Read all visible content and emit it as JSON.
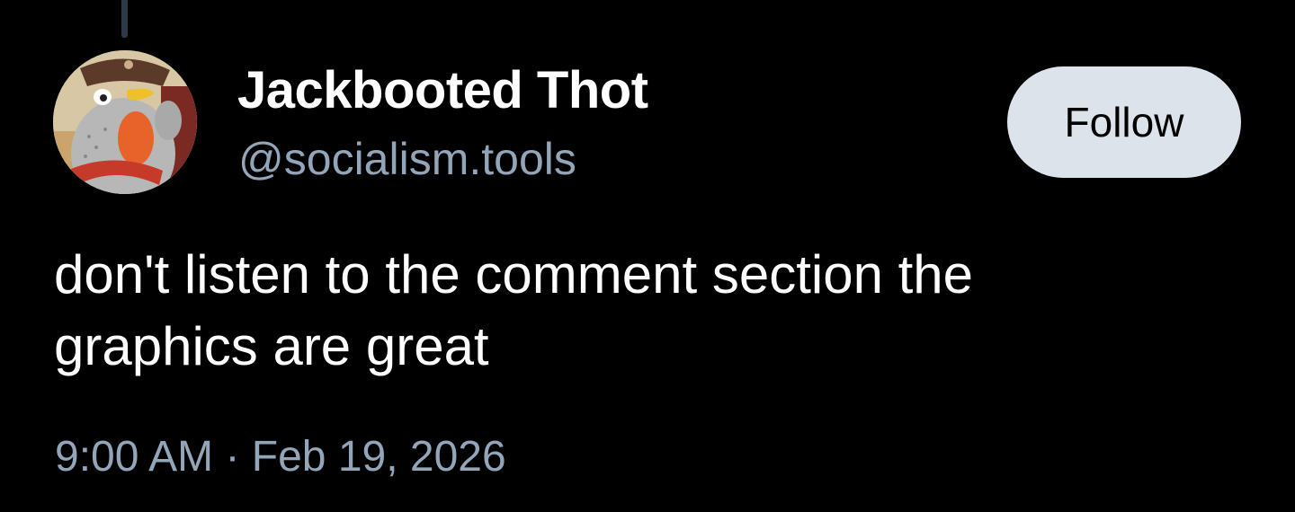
{
  "post": {
    "author": {
      "display_name": "Jackbooted Thot",
      "handle": "@socialism.tools",
      "avatar_icon": "penguin-cowboy-avatar"
    },
    "follow_label": "Follow",
    "text_lines": [
      "don't listen to the comment section the",
      "graphics are great"
    ],
    "time": "9:00 AM",
    "separator": "·",
    "date": "Feb 19, 2026"
  },
  "colors": {
    "background": "#000000",
    "primary_text": "#ffffff",
    "secondary_text": "#93a5b8",
    "follow_button_bg": "#dde3ea",
    "follow_button_text": "#000000",
    "thread_line": "#2e3a47"
  }
}
